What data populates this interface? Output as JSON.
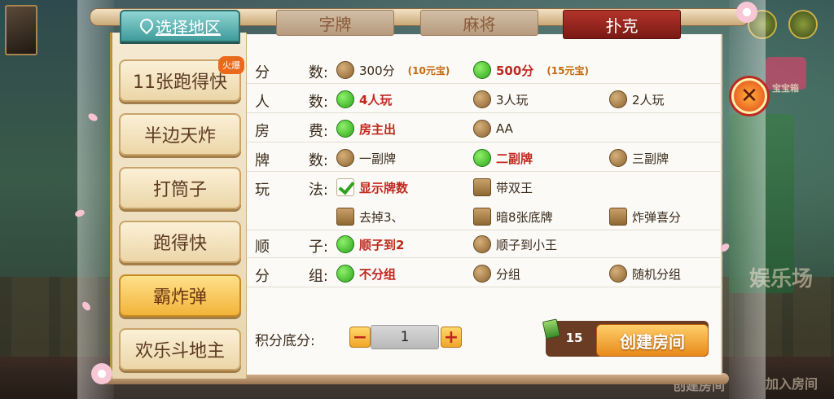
{
  "background": {
    "bg_label_1": "娱乐场",
    "bg_label_2": "加入房间",
    "bg_label_3": "创建房间",
    "gift_label": "宝宝箱"
  },
  "region_tab": {
    "label": "选择地区",
    "icon": "map-pin-icon"
  },
  "game_tabs": [
    {
      "label": "字牌",
      "active": false
    },
    {
      "label": "麻将",
      "active": false
    },
    {
      "label": "扑克",
      "active": true
    }
  ],
  "games": [
    {
      "label": "11张跑得快",
      "badge": "火爆",
      "active": false
    },
    {
      "label": "半边天炸",
      "active": false
    },
    {
      "label": "打筒子",
      "active": false
    },
    {
      "label": "跑得快",
      "active": false
    },
    {
      "label": "霸炸弹",
      "active": true
    },
    {
      "label": "欢乐斗地主",
      "active": false
    }
  ],
  "settings": {
    "score": {
      "label_a": "分",
      "label_b": "数:",
      "options": [
        {
          "label": "300分",
          "note": "(10元宝)",
          "selected": false
        },
        {
          "label": "500分",
          "note": "(15元宝)",
          "selected": true
        }
      ]
    },
    "players": {
      "label_a": "人",
      "label_b": "数:",
      "options": [
        {
          "label": "4人玩",
          "selected": true
        },
        {
          "label": "3人玩",
          "selected": false
        },
        {
          "label": "2人玩",
          "selected": false
        }
      ]
    },
    "fee": {
      "label_a": "房",
      "label_b": "费:",
      "options": [
        {
          "label": "房主出",
          "selected": true
        },
        {
          "label": "AA",
          "selected": false
        }
      ]
    },
    "decks": {
      "label_a": "牌",
      "label_b": "数:",
      "options": [
        {
          "label": "一副牌",
          "selected": false
        },
        {
          "label": "二副牌",
          "selected": true
        },
        {
          "label": "三副牌",
          "selected": false
        }
      ]
    },
    "rules": {
      "label_a": "玩",
      "label_b": "法:",
      "options": [
        {
          "label": "显示牌数",
          "checked": true
        },
        {
          "label": "带双王",
          "checked": false
        },
        {
          "label": "去掉3、",
          "checked": false
        },
        {
          "label": "暗8张底牌",
          "checked": false
        },
        {
          "label": "炸弹喜分",
          "checked": false
        }
      ]
    },
    "straight": {
      "label_a": "顺",
      "label_b": "子:",
      "options": [
        {
          "label": "顺子到2",
          "selected": true
        },
        {
          "label": "顺子到小王",
          "selected": false
        }
      ]
    },
    "grouping": {
      "label_a": "分",
      "label_b": "组:",
      "options": [
        {
          "label": "不分组",
          "selected": true
        },
        {
          "label": "分组",
          "selected": false
        },
        {
          "label": "随机分组",
          "selected": false
        }
      ]
    }
  },
  "base_score": {
    "label": "积分底分:",
    "value": "1",
    "minus": "−",
    "plus": "+"
  },
  "create": {
    "count": "15",
    "label": "创建房间"
  },
  "close": {
    "label": "✕"
  }
}
